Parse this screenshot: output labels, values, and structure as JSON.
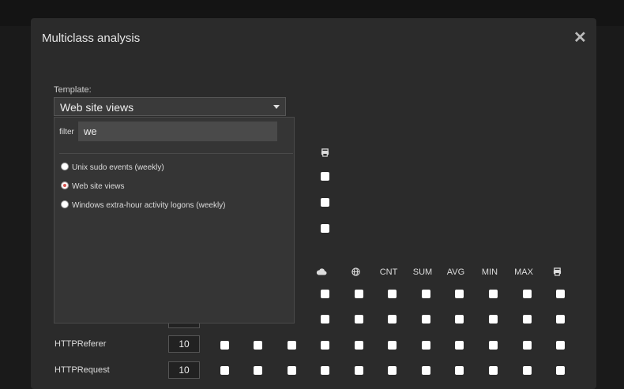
{
  "modal": {
    "title": "Multiclass analysis",
    "close_label": "✕"
  },
  "template": {
    "label": "Template:",
    "selected": "Web site views"
  },
  "dropdown": {
    "filter_label": "filter",
    "filter_value": "we",
    "options": [
      {
        "label": "Unix sudo events (weekly)",
        "selected": false
      },
      {
        "label": "Web site views",
        "selected": true
      },
      {
        "label": "Windows extra-hour activity logons (weekly)",
        "selected": false
      }
    ]
  },
  "headers": {
    "cnt": "CNT",
    "sum": "SUM",
    "avg": "AVG",
    "min": "MIN",
    "max": "MAX"
  },
  "icons": {
    "cloud": "cloud-icon",
    "globe": "globe-icon",
    "print": "print-icon"
  },
  "rows": [
    {
      "label": "HTTPReferer",
      "value": "10"
    },
    {
      "label": "HTTPRequest",
      "value": "10"
    }
  ]
}
